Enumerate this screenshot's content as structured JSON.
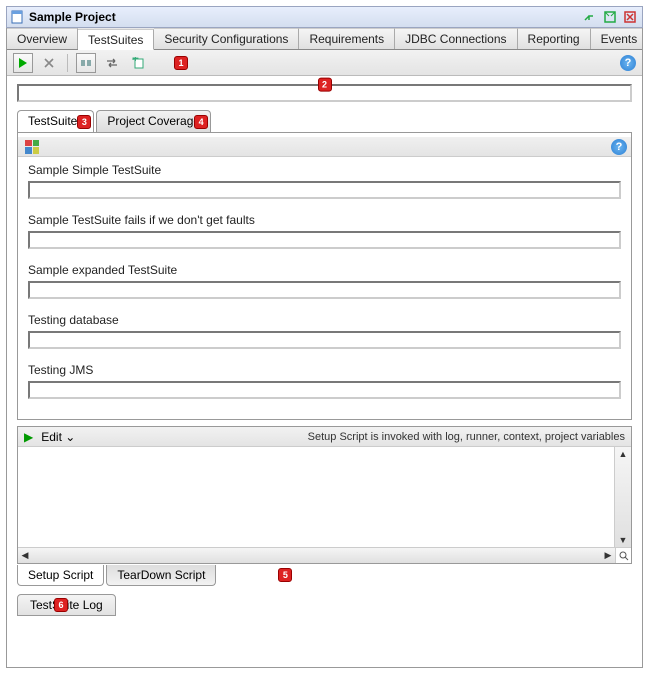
{
  "window": {
    "title": "Sample Project"
  },
  "main_tabs": [
    "Overview",
    "TestSuites",
    "Security Configurations",
    "Requirements",
    "JDBC Connections",
    "Reporting",
    "Events"
  ],
  "active_main_tab": "TestSuites",
  "callouts": {
    "toolbar": "1",
    "progress": "2",
    "subtab_testsuites": "3",
    "subtab_coverage": "4",
    "teardown": "5",
    "log": "6"
  },
  "sub_tabs": {
    "items": [
      "TestSuites",
      "Project Coverage"
    ],
    "active": "TestSuites"
  },
  "suites": [
    {
      "label": "Sample Simple TestSuite"
    },
    {
      "label": "Sample TestSuite fails if we don't get faults"
    },
    {
      "label": "Sample expanded TestSuite"
    },
    {
      "label": "Testing database"
    },
    {
      "label": "Testing JMS"
    }
  ],
  "script": {
    "edit_label": "Edit ⌄",
    "description": "Setup Script is invoked with log, runner, context, project variables",
    "tabs": [
      "Setup Script",
      "TearDown Script"
    ],
    "active_tab": "Setup Script"
  },
  "footer_tab": "TestSuite Log"
}
